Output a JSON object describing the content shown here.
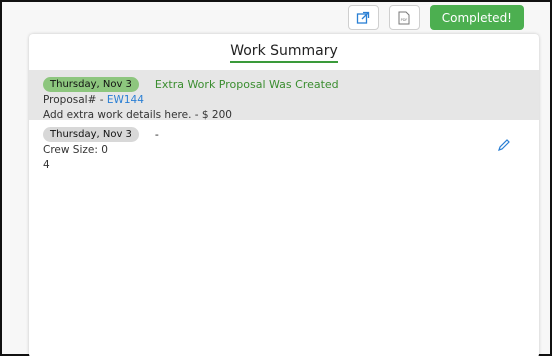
{
  "toolbar": {
    "export_icon": "external-link-icon",
    "pdf_icon": "pdf-icon",
    "pdf_text": "PDF",
    "complete_label": "Completed!"
  },
  "card": {
    "title": "Work Summary",
    "entries": [
      {
        "date": "Thursday, Nov 3",
        "title": "Extra Work Proposal Was Created",
        "proposal_prefix": "Proposal# - ",
        "proposal_id": "EW144",
        "details": "Add extra work details here. - $ 200"
      },
      {
        "date": "Thursday, Nov 3",
        "title": "-",
        "crew_size": "Crew Size: 0",
        "extra": "4"
      }
    ]
  },
  "colors": {
    "accent_green": "#4caf50",
    "link_blue": "#2a7fd4"
  }
}
